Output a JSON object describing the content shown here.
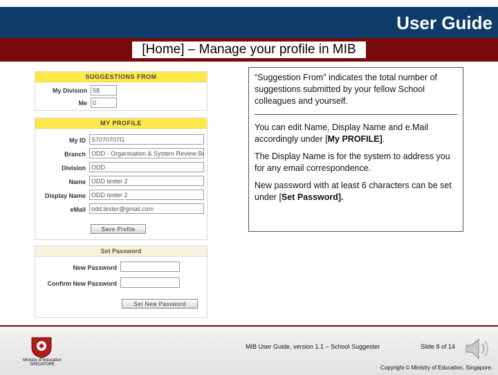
{
  "header": {
    "title": "User Guide",
    "subtitle": "[Home] – Manage your profile in MIB"
  },
  "suggestions": {
    "heading": "SUGGESTIONS FROM",
    "rows": [
      {
        "label": "My Division",
        "value": "58"
      },
      {
        "label": "Me",
        "value": "0"
      }
    ]
  },
  "profile": {
    "heading": "MY PROFILE",
    "fields": [
      {
        "label": "My ID",
        "value": "S7070707G"
      },
      {
        "label": "Branch",
        "value": "ODD - Organisation & System Review Br"
      },
      {
        "label": "Division",
        "value": "ODD"
      },
      {
        "label": "Name",
        "value": "ODD tester 2"
      },
      {
        "label": "Display Name",
        "value": "ODD tester 2"
      },
      {
        "label": "eMail",
        "value": "odd.tester@gmail.com"
      }
    ],
    "save_button": "Save Profile"
  },
  "password": {
    "heading": "Set Password",
    "new_label": "New Password",
    "confirm_label": "Confirm New Password",
    "set_button": "Set New Password"
  },
  "info": {
    "p1": "“Suggestion From” indicates the total number of suggestions submitted by your fellow School colleagues and yourself.",
    "p2a": "You can edit Name, Display Name and e.Mail accordingly under [",
    "p2b": "My PROFILE]",
    "p2c": ".",
    "p3": "The Display Name is for the system to address you for any email correspondence.",
    "p4a": "New password with at least 6 characters can be set under [",
    "p4b": "Set Password]."
  },
  "footer": {
    "version": "MIB User Guide, version 1.1 – School Suggester",
    "slide": "Slide 8 of 14",
    "copyright": "Copyright © Ministry of Education, Singapore.",
    "ministry": "Ministry of Education SINGAPORE"
  },
  "colors": {
    "header_blue": "#0e3b68",
    "header_red": "#7a0a0a",
    "panel_yellow": "#ffe94a"
  }
}
